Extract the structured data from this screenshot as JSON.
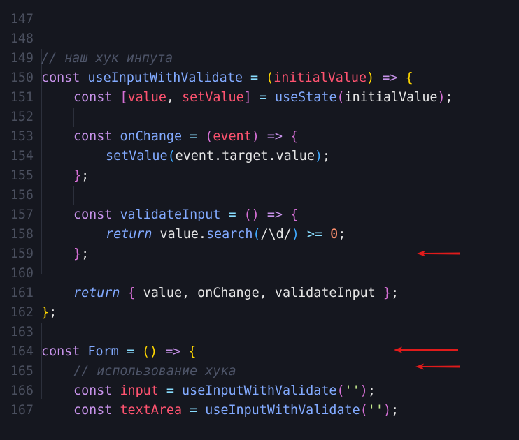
{
  "colors": {
    "background": "#15171f",
    "line_number": "#4a4f5e",
    "arrow": "#e01b1b"
  },
  "editor": {
    "line_numbers": [
      "147",
      "148",
      "149",
      "150",
      "151",
      "152",
      "153",
      "154",
      "155",
      "156",
      "157",
      "158",
      "159",
      "160",
      "161",
      "162",
      "163",
      "164",
      "165",
      "166",
      "167"
    ],
    "tokens": {
      "l148": "// наш хук инпута",
      "l149_const": "const",
      "l149_name": "useInputWithValidate",
      "l149_eq": " = ",
      "l149_po": "(",
      "l149_param": "initialValue",
      "l149_pc": ")",
      "l149_arrow": " => ",
      "l149_brace": "{",
      "l150_const": "const",
      "l150_bo": "[",
      "l150_v1": "value",
      "l150_comma": ", ",
      "l150_v2": "setValue",
      "l150_bc": "]",
      "l150_eq": " = ",
      "l150_fn": "useState",
      "l150_po": "(",
      "l150_arg": "initialValue",
      "l150_pc": ")",
      "l150_semi": ";",
      "l152_const": "const",
      "l152_name": "onChange",
      "l152_eq": " = ",
      "l152_po": "(",
      "l152_param": "event",
      "l152_pc": ")",
      "l152_arrow": " => ",
      "l152_brace": "{",
      "l153_fn": "setValue",
      "l153_po": "(",
      "l153_arg": "event.target.value",
      "l153_pc": ")",
      "l153_semi": ";",
      "l154_brace": "}",
      "l154_semi": ";",
      "l156_const": "const",
      "l156_name": "validateInput",
      "l156_eq": " = ",
      "l156_parens": "()",
      "l156_arrow": " => ",
      "l156_brace": "{",
      "l157_ret": "return",
      "l157_obj": "value.",
      "l157_fn": "search",
      "l157_po": "(",
      "l157_regex": "/\\d/",
      "l157_pc": ")",
      "l157_op": " >= ",
      "l157_num": "0",
      "l157_semi": ";",
      "l158_brace": "}",
      "l158_semi": ";",
      "l160_ret": "return",
      "l160_bo": "{",
      "l160_body": " value, onChange, validateInput ",
      "l160_bc": "}",
      "l160_semi": ";",
      "l161_brace": "}",
      "l161_semi": ";",
      "l163_const": "const",
      "l163_name": "Form",
      "l163_eq": " = ",
      "l163_parens": "()",
      "l163_arrow": " => ",
      "l163_brace": "{",
      "l164": "// использование хука",
      "l165_const": "const",
      "l165_name": "input",
      "l165_eq": " = ",
      "l165_fn": "useInputWithValidate",
      "l165_po": "(",
      "l165_str": "''",
      "l165_pc": ")",
      "l165_semi": ";",
      "l166_const": "const",
      "l166_name": "textArea",
      "l166_eq": " = ",
      "l166_fn": "useInputWithValidate",
      "l166_po": "(",
      "l166_str": "''",
      "l166_pc": ")",
      "l166_semi": ";"
    }
  }
}
